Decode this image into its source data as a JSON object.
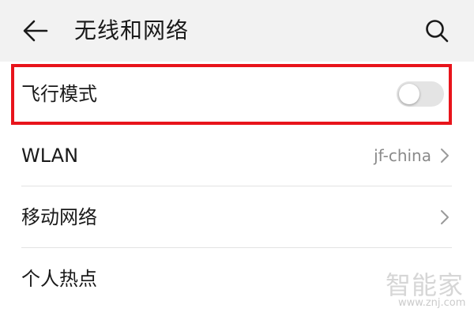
{
  "header": {
    "title": "无线和网络",
    "back_icon": "arrow-left-icon",
    "search_icon": "search-icon"
  },
  "settings": {
    "airplane_mode": {
      "label": "飞行模式",
      "enabled": false
    },
    "wlan": {
      "label": "WLAN",
      "value": "jf-china"
    },
    "mobile_network": {
      "label": "移动网络"
    },
    "hotspot": {
      "label": "个人热点"
    }
  },
  "annotation": {
    "highlight_color": "#e8141b"
  },
  "watermark": {
    "text": "智能家",
    "url": "www.znj.com"
  },
  "colors": {
    "header_bg": "#f2f2f2",
    "toggle_off": "#e4e4e4",
    "secondary_text": "#8a8a8a"
  }
}
